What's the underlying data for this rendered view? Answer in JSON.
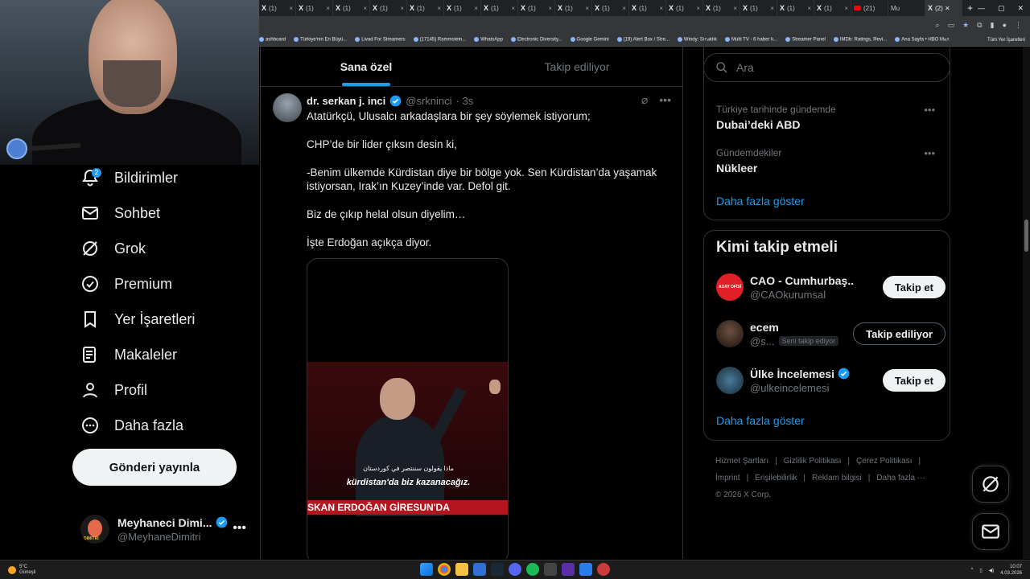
{
  "browser": {
    "tabs": [
      {
        "label": "(1)"
      },
      {
        "label": "(1)"
      },
      {
        "label": "(1)"
      },
      {
        "label": "(1)"
      },
      {
        "label": "(1)"
      },
      {
        "label": "(1)"
      },
      {
        "label": "(1)"
      },
      {
        "label": "(1)"
      },
      {
        "label": "(1)"
      },
      {
        "label": "(1)"
      },
      {
        "label": "(1)"
      },
      {
        "label": "(1)"
      },
      {
        "label": "(1)"
      },
      {
        "label": "(1)"
      },
      {
        "label": "(1)"
      },
      {
        "label": "(1)"
      }
    ],
    "yt_tab": "(21)",
    "mu_tab": "Mu",
    "active_tab": "(2) ✕",
    "bookmarks": [
      "ashboard",
      "Türkiye'nin En Büyü...",
      "Livad For Streamers",
      "(17145) Rammstein...",
      "WhatsApp",
      "Electronic Diversity...",
      "Google Gemini",
      "(19) Alert Box / Stre...",
      "Windy: Sıcaklık",
      "Multi TV - 6 haber k...",
      "Streamer Panel",
      "IMDb: Ratings, Revi...",
      "Ana Sayfa • HBO Max"
    ],
    "bookmarks_right": "Tüm Yer İşaretleri"
  },
  "nav": {
    "items": [
      {
        "label": "Bildirimler",
        "icon": "bell-icon"
      },
      {
        "label": "Sohbet",
        "icon": "mail-icon"
      },
      {
        "label": "Grok",
        "icon": "grok-icon"
      },
      {
        "label": "Premium",
        "icon": "verified-icon"
      },
      {
        "label": "Yer İşaretleri",
        "icon": "bookmark-icon"
      },
      {
        "label": "Makaleler",
        "icon": "article-icon"
      },
      {
        "label": "Profil",
        "icon": "person-icon"
      },
      {
        "label": "Daha fazla",
        "icon": "more-circle-icon"
      }
    ],
    "notif_badge": "2",
    "post_button": "Gönderi yayınla",
    "account": {
      "name": "Meyhaneci Dimi...",
      "handle": "@MeyhaneDimitri",
      "avatar_text": "DIMITRI"
    }
  },
  "main": {
    "tabs": [
      {
        "label": "Sana özel",
        "active": true
      },
      {
        "label": "Takip ediliyor",
        "active": false
      }
    ],
    "tweet": {
      "name": "dr. serkan j. inci",
      "handle": "@srkninci",
      "time": "· 3s",
      "paragraphs": [
        "Atatürkçü, Ulusalcı arkadaşlara bir şey söylemek istiyorum;",
        "CHP’de bir lider çıksın desin ki,",
        "-Benim ülkemde Kürdistan diye bir bölge yok. Sen Kürdistan’da yaşamak istiyorsan, Irak’ın Kuzey’inde var. Defol git.",
        "Biz de çıkıp helal olsun diyelim…",
        "İşte Erdoğan açıkça diyor."
      ],
      "video": {
        "subtitle_ar": "ماذا يقولون سننتصر في كوردستان",
        "subtitle_tr": "kürdistan'da biz kazanacağız.",
        "banner": "SKAN ERDOĞAN GİRESUN'DA"
      }
    }
  },
  "right": {
    "search_placeholder": "Ara",
    "trends": [
      {
        "category": "Türkiye tarihinde gündemde",
        "title": "Dubai’deki ABD"
      },
      {
        "category": "Gündemdekiler",
        "title": "Nükleer"
      }
    ],
    "show_more": "Daha fazla göster",
    "follow_title": "Kimi takip etmeli",
    "suggestions": [
      {
        "name": "CAO - Cumhurbaş...",
        "handle": "@CAOkurumsal",
        "button": "Takip et",
        "verified": true,
        "avatar_text": "ADAY OFİSİ"
      },
      {
        "name": "ecem",
        "handle": "@s...",
        "follows_you": "Seni takip ediyor",
        "button": "Takip ediliyor",
        "verified": false
      },
      {
        "name": "Ülke İncelemesi",
        "handle": "@ulkeincelemesi",
        "button": "Takip et",
        "verified": true
      }
    ],
    "show_more_2": "Daha fazla göster",
    "footer": [
      "Hizmet Şartları",
      "|",
      "Gizlilik Politikası",
      "|",
      "Çerez Politikası",
      "|",
      "İmprint",
      "|",
      "Erişilebilirlik",
      "|",
      "Reklam bilgisi",
      "|",
      "Daha fazla ···",
      "© 2026 X Corp."
    ]
  },
  "taskbar": {
    "temp": "5°C",
    "weather": "Güneşli",
    "time": "10:07",
    "date": "4.03.2026"
  },
  "colors": {
    "accent": "#1d9bf0",
    "bg": "#000000",
    "border": "#2f3336",
    "muted": "#71767b"
  }
}
